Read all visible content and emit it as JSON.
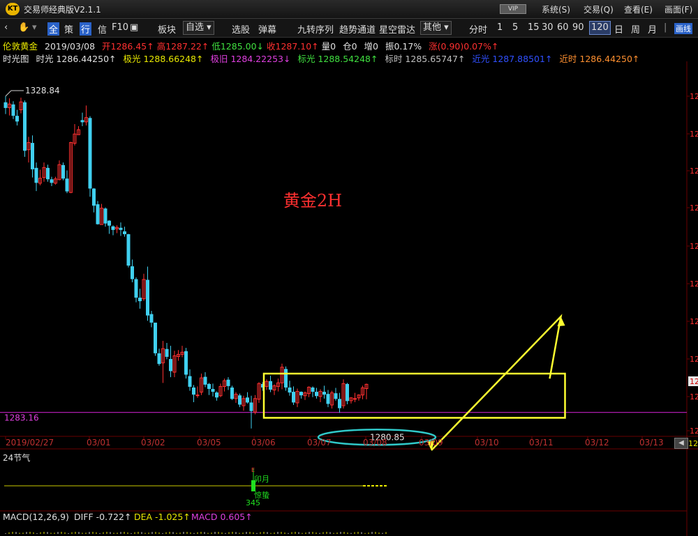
{
  "window": {
    "logo": "KT",
    "title": "交易师经典版V2.1.1",
    "vip_label": "VIP",
    "menus": [
      "系统(S)",
      "交易(Q)",
      "查看(E)",
      "画面(F)"
    ]
  },
  "toolbar": {
    "items": [
      "全",
      "策",
      "行",
      "信",
      "F10",
      "板块",
      "自选",
      "选股",
      "弹幕",
      "九转序列",
      "趋势通道",
      "星空雷达",
      "其他",
      "分时",
      "1",
      "5",
      "15",
      "30",
      "60",
      "90",
      "120",
      "日",
      "周",
      "月"
    ],
    "selected_period": "120",
    "right_button": "画线"
  },
  "quote": {
    "symbol": "伦敦黄金",
    "date": "2019/03/08",
    "open": "开1286.45↑",
    "high": "高1287.22↑",
    "low": "低1285.00↓",
    "close": "收1287.10↑",
    "volume": "量0",
    "position": "仓0",
    "increase": "增0",
    "amplitude": "振0.17%",
    "change": "涨(0.90)0.07%↑"
  },
  "indicator_line": {
    "name": "时光图",
    "items": [
      {
        "text": "时光 1286.44250↑",
        "color": "#e0e0e0"
      },
      {
        "text": "极光 1288.66248↑",
        "color": "#e8e800"
      },
      {
        "text": "极旧 1284.22253↓",
        "color": "#e040e0"
      },
      {
        "text": "标光 1288.54248↑",
        "color": "#40e040"
      },
      {
        "text": "标时 1285.65747↑",
        "color": "#c0c0c0"
      },
      {
        "text": "近光 1287.88501↑",
        "color": "#3050ff"
      },
      {
        "text": "近时 1286.44250↑",
        "color": "#ff9030"
      }
    ]
  },
  "chart_data": {
    "type": "candlestick",
    "title": "黄金2H",
    "max_label": "1328.84",
    "min_label": "1280.85",
    "hline_label": "1283.16",
    "hline_value": 1283.16,
    "ylim": [
      1280,
      1332
    ],
    "dates": [
      "2019/02/27",
      "03/01",
      "03/02",
      "03/05",
      "03/06",
      "03/07",
      "03/08",
      "03/09",
      "03/10",
      "03/11",
      "03/12",
      "03/13"
    ],
    "colors": {
      "up": "#ff3030",
      "down": "#40d0f0",
      "annotation": "#ffff30",
      "ellipse": "#30c8c8",
      "title": "#ff3030",
      "grid": "#6a0000"
    },
    "candles": [
      [
        1326.6,
        1327.5,
        1325.0,
        1325.9
      ],
      [
        1325.9,
        1327.2,
        1324.8,
        1326.4
      ],
      [
        1326.3,
        1326.8,
        1324.3,
        1324.8
      ],
      [
        1324.7,
        1325.6,
        1323.4,
        1324.0
      ],
      [
        1325.6,
        1327.3,
        1325.1,
        1326.7
      ],
      [
        1326.6,
        1326.9,
        1319.0,
        1319.9
      ],
      [
        1320.0,
        1321.8,
        1318.2,
        1321.0
      ],
      [
        1320.9,
        1322.0,
        1316.1,
        1317.3
      ],
      [
        1317.4,
        1318.2,
        1314.2,
        1315.4
      ],
      [
        1315.3,
        1317.2,
        1315.0,
        1316.0
      ],
      [
        1316.1,
        1318.2,
        1315.5,
        1317.5
      ],
      [
        1317.4,
        1317.9,
        1315.5,
        1315.9
      ],
      [
        1315.8,
        1316.2,
        1314.9,
        1315.4
      ],
      [
        1315.3,
        1316.2,
        1315.1,
        1315.9
      ],
      [
        1315.8,
        1318.5,
        1315.7,
        1317.9
      ],
      [
        1317.8,
        1318.2,
        1315.7,
        1316.0
      ],
      [
        1315.9,
        1317.1,
        1313.9,
        1314.2
      ],
      [
        1314.0,
        1321.1,
        1313.9,
        1321.0
      ],
      [
        1320.9,
        1323.6,
        1320.6,
        1322.2
      ],
      [
        1322.1,
        1323.3,
        1322.1,
        1322.8
      ],
      [
        1324.1,
        1325.2,
        1323.3,
        1323.9
      ],
      [
        1323.9,
        1326.2,
        1323.4,
        1324.5
      ],
      [
        1324.4,
        1324.7,
        1313.4,
        1314.6
      ],
      [
        1314.5,
        1314.6,
        1311.2,
        1312.2
      ],
      [
        1312.3,
        1312.8,
        1309.5,
        1309.6
      ],
      [
        1309.5,
        1312.4,
        1309.5,
        1311.8
      ],
      [
        1311.7,
        1311.9,
        1309.2,
        1309.7
      ],
      [
        1310.0,
        1310.1,
        1308.2,
        1309.4
      ],
      [
        1309.2,
        1309.4,
        1308.0,
        1308.8
      ],
      [
        1308.9,
        1309.4,
        1308.3,
        1309.1
      ],
      [
        1309.0,
        1309.8,
        1307.9,
        1308.8
      ],
      [
        1308.5,
        1309.2,
        1307.8,
        1308.2
      ],
      [
        1308.1,
        1308.2,
        1303.5,
        1303.8
      ],
      [
        1303.6,
        1304.6,
        1301.4,
        1301.9
      ],
      [
        1301.8,
        1302.1,
        1298.6,
        1299.3
      ],
      [
        1299.2,
        1300.5,
        1297.7,
        1298.8
      ],
      [
        1299.1,
        1302.6,
        1298.8,
        1301.8
      ],
      [
        1301.7,
        1303.6,
        1296.0,
        1296.8
      ],
      [
        1296.9,
        1297.4,
        1295.1,
        1295.8
      ],
      [
        1295.7,
        1295.7,
        1291.1,
        1291.5
      ],
      [
        1291.4,
        1292.1,
        1289.7,
        1290.0
      ],
      [
        1290.1,
        1293.2,
        1287.3,
        1292.1
      ],
      [
        1292.0,
        1292.9,
        1290.6,
        1291.0
      ],
      [
        1290.6,
        1292.5,
        1288.1,
        1289.0
      ],
      [
        1288.8,
        1291.8,
        1288.1,
        1291.1
      ],
      [
        1291.0,
        1291.9,
        1290.4,
        1291.3
      ],
      [
        1291.3,
        1292.5,
        1290.9,
        1291.6
      ],
      [
        1291.7,
        1292.2,
        1287.9,
        1288.5
      ],
      [
        1288.2,
        1289.2,
        1286.2,
        1286.8
      ],
      [
        1286.6,
        1287.0,
        1284.6,
        1285.7
      ],
      [
        1285.6,
        1286.8,
        1285.2,
        1285.6
      ],
      [
        1286.0,
        1288.6,
        1285.6,
        1288.0
      ],
      [
        1288.1,
        1288.8,
        1286.7,
        1287.1
      ],
      [
        1287.1,
        1287.3,
        1285.6,
        1286.5
      ],
      [
        1286.4,
        1287.2,
        1285.4,
        1286.1
      ],
      [
        1285.9,
        1286.1,
        1284.8,
        1285.3
      ],
      [
        1285.5,
        1287.2,
        1285.3,
        1286.8
      ],
      [
        1286.8,
        1287.9,
        1286.1,
        1287.6
      ],
      [
        1287.7,
        1288.1,
        1286.3,
        1286.9
      ],
      [
        1286.6,
        1286.9,
        1284.9,
        1285.1
      ],
      [
        1285.1,
        1286.0,
        1284.5,
        1285.7
      ],
      [
        1285.5,
        1285.8,
        1283.9,
        1284.3
      ],
      [
        1284.1,
        1285.5,
        1283.4,
        1285.1
      ],
      [
        1285.2,
        1286.0,
        1284.4,
        1284.6
      ],
      [
        1284.5,
        1285.5,
        1280.9,
        1283.4
      ],
      [
        1283.2,
        1285.6,
        1282.9,
        1285.1
      ],
      [
        1285.0,
        1287.4,
        1284.5,
        1287.2
      ],
      [
        1287.1,
        1287.4,
        1286.2,
        1286.7
      ],
      [
        1286.8,
        1287.8,
        1286.3,
        1287.5
      ],
      [
        1287.5,
        1288.3,
        1286.0,
        1286.4
      ],
      [
        1286.3,
        1287.1,
        1285.6,
        1286.9
      ],
      [
        1286.8,
        1287.9,
        1286.1,
        1287.3
      ],
      [
        1287.3,
        1290.0,
        1286.4,
        1289.5
      ],
      [
        1289.2,
        1289.6,
        1286.2,
        1286.7
      ],
      [
        1286.6,
        1287.6,
        1285.5,
        1286.0
      ],
      [
        1286.0,
        1286.8,
        1284.2,
        1284.6
      ],
      [
        1284.5,
        1286.5,
        1283.9,
        1286.1
      ],
      [
        1286.0,
        1286.1,
        1285.1,
        1285.6
      ],
      [
        1285.5,
        1286.1,
        1284.9,
        1285.9
      ],
      [
        1285.8,
        1286.8,
        1285.3,
        1286.7
      ],
      [
        1286.6,
        1286.8,
        1285.3,
        1286.1
      ],
      [
        1286.0,
        1286.6,
        1285.1,
        1285.5
      ],
      [
        1285.4,
        1286.4,
        1284.6,
        1286.1
      ],
      [
        1286.0,
        1286.9,
        1285.1,
        1285.7
      ],
      [
        1285.7,
        1286.3,
        1283.9,
        1284.4
      ],
      [
        1284.2,
        1286.2,
        1283.7,
        1285.9
      ],
      [
        1285.8,
        1286.6,
        1284.8,
        1285.1
      ],
      [
        1285.0,
        1285.9,
        1283.1,
        1283.8
      ],
      [
        1284.1,
        1287.8,
        1283.7,
        1287.2
      ],
      [
        1287.1,
        1287.3,
        1284.3,
        1284.8
      ],
      [
        1284.8,
        1285.3,
        1284.4,
        1285.2
      ],
      [
        1285.0,
        1285.9,
        1284.6,
        1285.1
      ],
      [
        1285.2,
        1285.7,
        1284.8,
        1285.6
      ],
      [
        1285.6,
        1286.9,
        1285.0,
        1286.6
      ],
      [
        1286.5,
        1287.2,
        1285.0,
        1287.1
      ]
    ],
    "box": {
      "from": 68,
      "to": 145,
      "low": 1282.4,
      "high": 1288.6
    },
    "projection": [
      1287.9,
      1296.6,
      1276.2
    ],
    "right_axis_label": "12",
    "scroll_axis_label": "12"
  },
  "solar_panel": {
    "title": "24节气",
    "term_labels": [
      "卯月",
      "惊蛰"
    ],
    "number": "345",
    "marker": "E"
  },
  "macd": {
    "name": "MACD(12,26,9)",
    "diff": "DIFF -0.722↑",
    "dea": "DEA -1.025↑",
    "macd": "MACD 0.605↑"
  }
}
